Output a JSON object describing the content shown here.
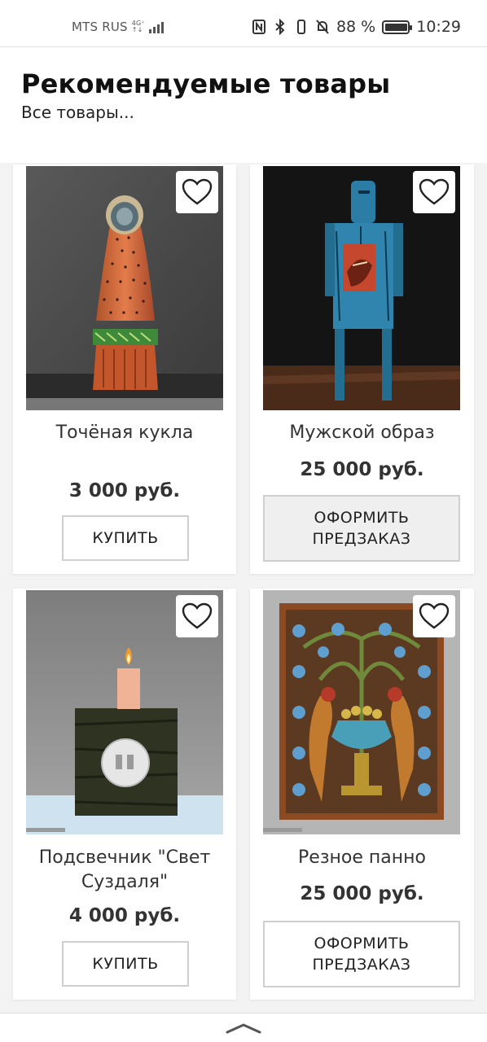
{
  "status_bar": {
    "carrier": "MTS RUS",
    "network_top": "4G⁺",
    "network_bottom": "↑↓",
    "battery_percent": "88 %",
    "battery_level": 0.88,
    "time": "10:29"
  },
  "header": {
    "title": "Рекомендуемые товары",
    "all_products_link": "Все товары..."
  },
  "products": [
    {
      "title": "Точёная кукла",
      "price": "3 000 руб.",
      "button": "КУПИТЬ",
      "favorite_icon": "heart-outline-icon"
    },
    {
      "title": "Мужской образ",
      "price": "25 000 руб.",
      "button": "ОФОРМИТЬ ПРЕДЗАКАЗ",
      "favorite_icon": "heart-outline-icon"
    },
    {
      "title": "Подсвечник \"Свет Суздаля\"",
      "price": "4 000 руб.",
      "button": "КУПИТЬ",
      "favorite_icon": "heart-outline-icon"
    },
    {
      "title": "Резное панно",
      "price": "25 000 руб.",
      "button": "ОФОРМИТЬ ПРЕДЗАКАЗ",
      "favorite_icon": "heart-outline-icon"
    }
  ],
  "bottom_bar": {
    "icon": "chevron-up-icon"
  }
}
